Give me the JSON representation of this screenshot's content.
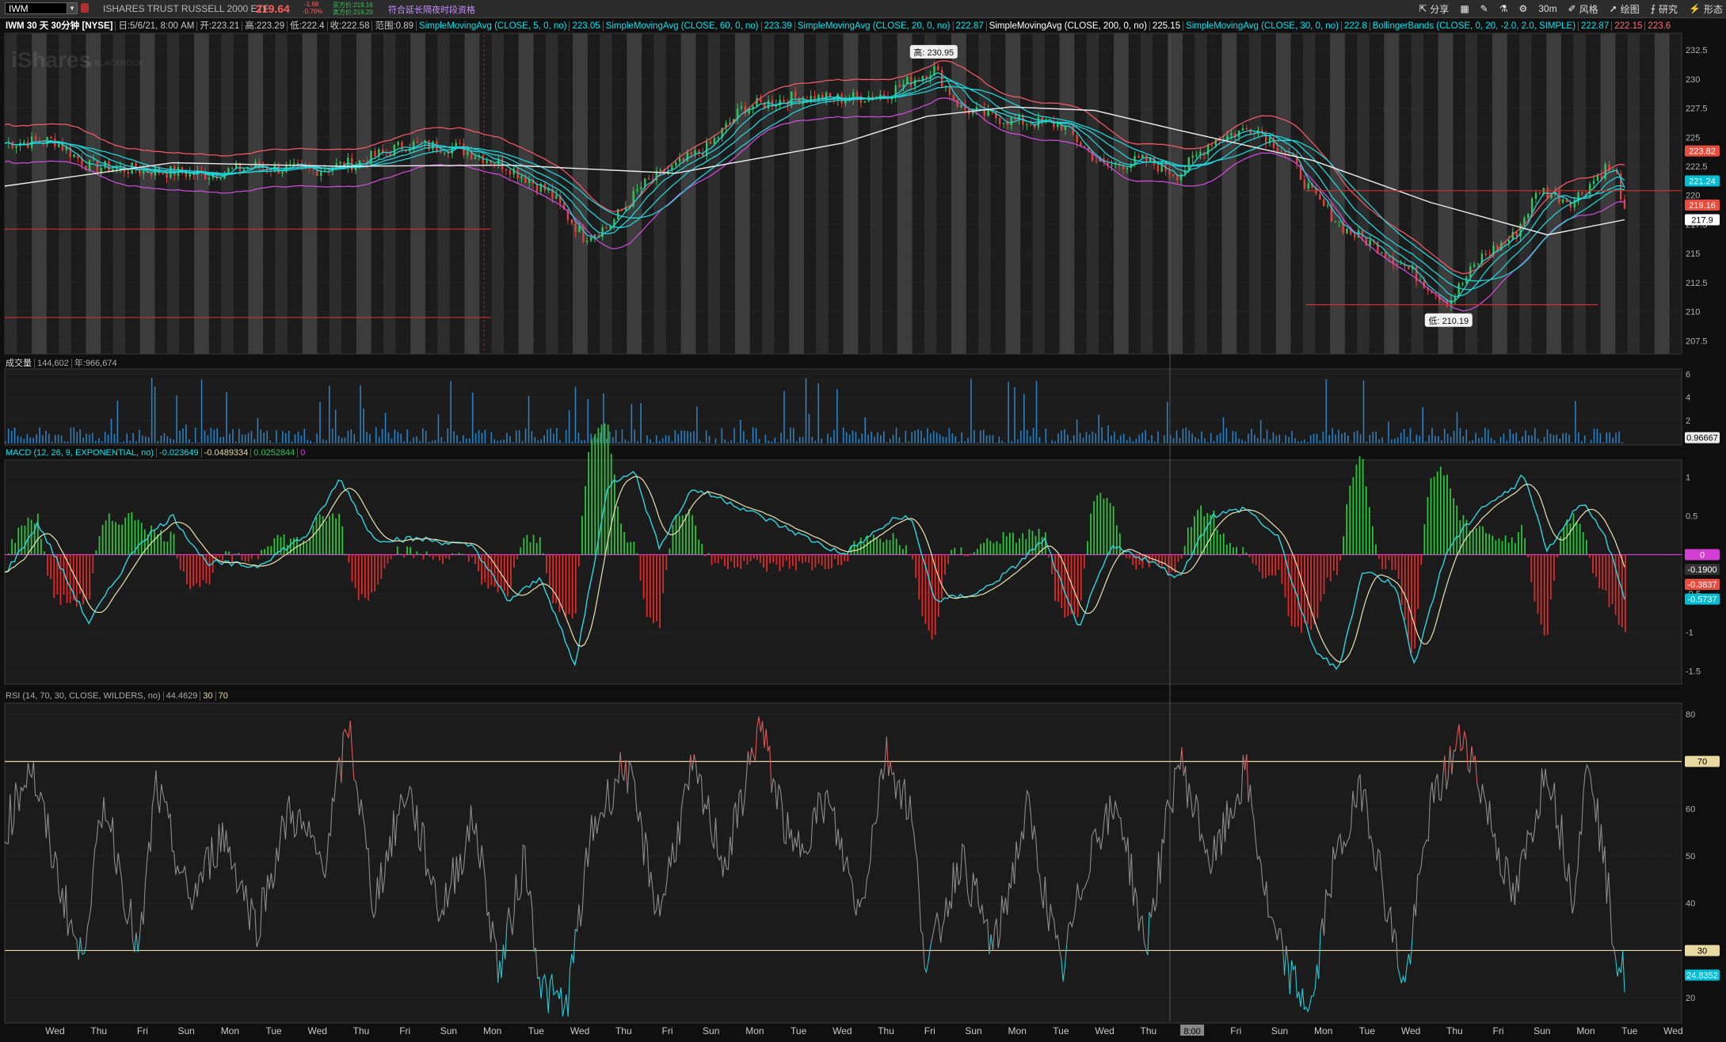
{
  "symbol": {
    "value": "IWM",
    "name": "ISHARES TRUST RUSSELL 2000 ETF",
    "price": "219.64",
    "change": "-1.68",
    "change_pct": "-0.76%",
    "bid": "买方价:219.16",
    "ask": "卖方价:219.20",
    "extended_hours": "符合延长隔夜时段资格"
  },
  "toolbar": {
    "share": "分享",
    "interval": "30m",
    "style": "风格",
    "drawing": "绘图",
    "studies": "研究",
    "pattern": "形态"
  },
  "chart_header": {
    "title": "IWM 30 天 30分钟 [NYSE]",
    "date": "日:5/6/21, 8:00 AM",
    "open": "开:223.21",
    "high": "高:223.29",
    "low": "低:222.4",
    "close": "收:222.58",
    "range": "范围:0.89",
    "studies": [
      {
        "label": "SimpleMovingAvg (CLOSE, 5, 0, no)",
        "value": "223.05",
        "color": "#00e5ee"
      },
      {
        "label": "SimpleMovingAvg (CLOSE, 60, 0, no)",
        "value": "223.39",
        "color": "#00e5ee"
      },
      {
        "label": "SimpleMovingAvg (CLOSE, 20, 0, no)",
        "value": "222.87",
        "color": "#00e5ee"
      },
      {
        "label": "SimpleMovingAvg (CLOSE, 200, 0, no)",
        "value": "225.15",
        "color": "#ffffff"
      },
      {
        "label": "SimpleMovingAvg (CLOSE, 30, 0, no)",
        "value": "222.8",
        "color": "#00e5ee"
      },
      {
        "label": "BollingerBands (CLOSE, 0, 20, -2.0, 2.0, SIMPLE)",
        "value": "222.87",
        "color": "#00e5ee"
      }
    ],
    "bb_upper": "222.15",
    "bb_lower": "223.6"
  },
  "watermark": {
    "brand": "iShares",
    "by": "by BLACKROCK"
  },
  "chart_data": [
    {
      "type": "candlestick",
      "title": "IWM 30 天 30分钟 [NYSE]",
      "yticks": [
        207.5,
        210,
        212.5,
        215,
        217.5,
        220,
        222.5,
        225,
        227.5,
        230,
        232.5
      ],
      "ylim": [
        206.5,
        233.8
      ],
      "x_labels": [
        "Wed",
        "Thu",
        "Fri",
        "Sun",
        "Mon",
        "Tue",
        "Wed",
        "Thu",
        "Fri",
        "Sun",
        "Mon",
        "Tue",
        "Wed",
        "Thu",
        "Fri",
        "Sun",
        "Mon",
        "Tue",
        "Wed",
        "Thu",
        "Fri",
        "Sun",
        "Mon",
        "Tue",
        "Wed",
        "Thu",
        "8:00",
        "Fri",
        "Sun",
        "Mon",
        "Tue",
        "Wed",
        "Thu",
        "Fri",
        "Sun",
        "Mon",
        "Tue",
        "Wed"
      ],
      "annotations": [
        {
          "label": "高: 230.95",
          "x": 0.554,
          "y": 230.95
        },
        {
          "label": "低: 210.19",
          "x": 0.861,
          "y": 210.19
        }
      ],
      "price_path": [
        [
          0,
          224.5
        ],
        [
          0.03,
          224.7
        ],
        [
          0.05,
          222.5
        ],
        [
          0.08,
          222.2
        ],
        [
          0.12,
          221.8
        ],
        [
          0.15,
          222.5
        ],
        [
          0.18,
          222.1
        ],
        [
          0.21,
          222.8
        ],
        [
          0.24,
          224.4
        ],
        [
          0.27,
          224.1
        ],
        [
          0.3,
          222.5
        ],
        [
          0.325,
          220.2
        ],
        [
          0.345,
          216.5
        ],
        [
          0.36,
          217.3
        ],
        [
          0.38,
          220.8
        ],
        [
          0.4,
          222.5
        ],
        [
          0.42,
          224.2
        ],
        [
          0.44,
          227.5
        ],
        [
          0.47,
          228.4
        ],
        [
          0.5,
          228.3
        ],
        [
          0.525,
          228.7
        ],
        [
          0.554,
          230.9
        ],
        [
          0.57,
          227.5
        ],
        [
          0.6,
          226.4
        ],
        [
          0.63,
          226.1
        ],
        [
          0.655,
          222.5
        ],
        [
          0.68,
          223.0
        ],
        [
          0.7,
          221.8
        ],
        [
          0.72,
          224.7
        ],
        [
          0.745,
          225.9
        ],
        [
          0.765,
          223.6
        ],
        [
          0.78,
          220.0
        ],
        [
          0.8,
          217.0
        ],
        [
          0.82,
          215.5
        ],
        [
          0.84,
          213.3
        ],
        [
          0.861,
          210.8
        ],
        [
          0.88,
          214.6
        ],
        [
          0.9,
          216.5
        ],
        [
          0.915,
          220.5
        ],
        [
          0.935,
          219.5
        ],
        [
          0.955,
          222.4
        ],
        [
          0.962,
          221.5
        ],
        [
          0.966,
          218.3
        ]
      ],
      "sma200_path": [
        [
          0,
          220.8
        ],
        [
          0.1,
          222.8
        ],
        [
          0.2,
          222.5
        ],
        [
          0.3,
          222.6
        ],
        [
          0.4,
          221.9
        ],
        [
          0.5,
          224.5
        ],
        [
          0.55,
          226.8
        ],
        [
          0.6,
          227.6
        ],
        [
          0.65,
          227.3
        ],
        [
          0.7,
          225.6
        ],
        [
          0.78,
          223.0
        ],
        [
          0.85,
          219.4
        ],
        [
          0.92,
          216.6
        ],
        [
          0.966,
          217.9
        ]
      ],
      "resistance_lines": [
        {
          "y": 217.1,
          "x0": 0.0,
          "x1": 0.29
        },
        {
          "y": 209.5,
          "x0": 0.0,
          "x1": 0.29
        },
        {
          "y": 210.6,
          "x0": 0.776,
          "x1": 0.95
        },
        {
          "y": 220.4,
          "x0": 0.776,
          "x1": 1.0
        }
      ],
      "price_badges": [
        {
          "label": "223.82",
          "y": 223.82,
          "color": "#e74c3c"
        },
        {
          "label": "221.24",
          "y": 221.24,
          "color": "#00bcd4"
        },
        {
          "label": "219.16",
          "y": 219.16,
          "color": "#e74c3c"
        },
        {
          "label": "217.9",
          "y": 217.9,
          "color": "#ffffff"
        }
      ]
    },
    {
      "type": "bar",
      "title": "成交量",
      "values_label": "144,602",
      "avg_label": "年:966,674",
      "yticks": [
        2,
        4,
        6
      ],
      "ylim": [
        0,
        6.3
      ],
      "last_label": "0.96667"
    },
    {
      "type": "line",
      "title": "MACD (12, 26, 9, EXPONENTIAL, no)",
      "values": [
        "-0.023649",
        "-0.0489334",
        "0.0252844",
        "0"
      ],
      "yticks": [
        -1.5,
        -1,
        -0.5,
        0,
        0.5,
        1
      ],
      "ylim": [
        -1.65,
        1.2
      ],
      "macd_path": [
        [
          0,
          -0.25
        ],
        [
          0.02,
          0.4
        ],
        [
          0.05,
          -0.88
        ],
        [
          0.08,
          0.15
        ],
        [
          0.1,
          0.5
        ],
        [
          0.12,
          -0.1
        ],
        [
          0.15,
          -0.15
        ],
        [
          0.18,
          0.25
        ],
        [
          0.2,
          0.98
        ],
        [
          0.22,
          0.2
        ],
        [
          0.25,
          0.2
        ],
        [
          0.28,
          0.1
        ],
        [
          0.3,
          -0.6
        ],
        [
          0.32,
          -0.3
        ],
        [
          0.34,
          -1.45
        ],
        [
          0.36,
          0.9
        ],
        [
          0.375,
          1.1
        ],
        [
          0.39,
          0.1
        ],
        [
          0.41,
          0.85
        ],
        [
          0.43,
          0.7
        ],
        [
          0.45,
          0.5
        ],
        [
          0.47,
          0.3
        ],
        [
          0.5,
          0.0
        ],
        [
          0.53,
          0.45
        ],
        [
          0.54,
          0.5
        ],
        [
          0.555,
          -0.6
        ],
        [
          0.58,
          -0.5
        ],
        [
          0.6,
          -0.2
        ],
        [
          0.62,
          0.2
        ],
        [
          0.64,
          -0.95
        ],
        [
          0.66,
          0.1
        ],
        [
          0.68,
          -0.05
        ],
        [
          0.7,
          -0.3
        ],
        [
          0.72,
          0.5
        ],
        [
          0.74,
          0.6
        ],
        [
          0.76,
          0.2
        ],
        [
          0.78,
          -1.2
        ],
        [
          0.795,
          -1.5
        ],
        [
          0.81,
          -0.2
        ],
        [
          0.83,
          -0.4
        ],
        [
          0.84,
          -1.45
        ],
        [
          0.86,
          0.05
        ],
        [
          0.88,
          0.6
        ],
        [
          0.9,
          0.85
        ],
        [
          0.905,
          1.1
        ],
        [
          0.92,
          0.05
        ],
        [
          0.94,
          0.7
        ],
        [
          0.955,
          0.2
        ],
        [
          0.966,
          -0.57
        ]
      ],
      "badges": [
        {
          "label": "0",
          "y": 0,
          "color": "#d23fd2"
        },
        {
          "label": "-0.1900",
          "y": -0.19,
          "color": "#333333"
        },
        {
          "label": "-0.3837",
          "y": -0.3837,
          "color": "#e74c3c"
        },
        {
          "label": "-0.5737",
          "y": -0.5737,
          "color": "#00bcd4"
        }
      ]
    },
    {
      "type": "line",
      "title": "RSI (14, 70, 30, CLOSE, WILDERS, no)",
      "values": [
        "44.4629",
        "30",
        "70"
      ],
      "yticks": [
        20,
        30,
        40,
        50,
        60,
        70,
        80
      ],
      "ylim": [
        15,
        82
      ],
      "overbought": 70,
      "oversold": 30,
      "rsi_path": [
        [
          0,
          55
        ],
        [
          0.015,
          70
        ],
        [
          0.03,
          48
        ],
        [
          0.045,
          28
        ],
        [
          0.06,
          62
        ],
        [
          0.08,
          28
        ],
        [
          0.09,
          65
        ],
        [
          0.11,
          40
        ],
        [
          0.13,
          55
        ],
        [
          0.15,
          35
        ],
        [
          0.17,
          60
        ],
        [
          0.19,
          48
        ],
        [
          0.205,
          78
        ],
        [
          0.22,
          40
        ],
        [
          0.24,
          65
        ],
        [
          0.26,
          38
        ],
        [
          0.28,
          58
        ],
        [
          0.295,
          25
        ],
        [
          0.31,
          50
        ],
        [
          0.32,
          22
        ],
        [
          0.335,
          18
        ],
        [
          0.35,
          55
        ],
        [
          0.37,
          70
        ],
        [
          0.39,
          38
        ],
        [
          0.41,
          68
        ],
        [
          0.43,
          48
        ],
        [
          0.45,
          78
        ],
        [
          0.47,
          50
        ],
        [
          0.49,
          62
        ],
        [
          0.51,
          38
        ],
        [
          0.525,
          72
        ],
        [
          0.54,
          60
        ],
        [
          0.55,
          26
        ],
        [
          0.57,
          50
        ],
        [
          0.59,
          30
        ],
        [
          0.61,
          60
        ],
        [
          0.63,
          25
        ],
        [
          0.65,
          55
        ],
        [
          0.665,
          60
        ],
        [
          0.68,
          30
        ],
        [
          0.7,
          71
        ],
        [
          0.72,
          48
        ],
        [
          0.74,
          68
        ],
        [
          0.755,
          35
        ],
        [
          0.77,
          22
        ],
        [
          0.78,
          18
        ],
        [
          0.79,
          45
        ],
        [
          0.81,
          65
        ],
        [
          0.825,
          38
        ],
        [
          0.835,
          22
        ],
        [
          0.85,
          60
        ],
        [
          0.87,
          76
        ],
        [
          0.88,
          65
        ],
        [
          0.9,
          40
        ],
        [
          0.92,
          70
        ],
        [
          0.935,
          42
        ],
        [
          0.945,
          72
        ],
        [
          0.955,
          45
        ],
        [
          0.962,
          27
        ],
        [
          0.966,
          25
        ]
      ],
      "badges": [
        {
          "label": "70",
          "y": 70,
          "color": "#e8d9a0"
        },
        {
          "label": "30",
          "y": 30,
          "color": "#e8d9a0"
        },
        {
          "label": "24.8352",
          "y": 24.8,
          "color": "#00bcd4"
        }
      ]
    }
  ]
}
